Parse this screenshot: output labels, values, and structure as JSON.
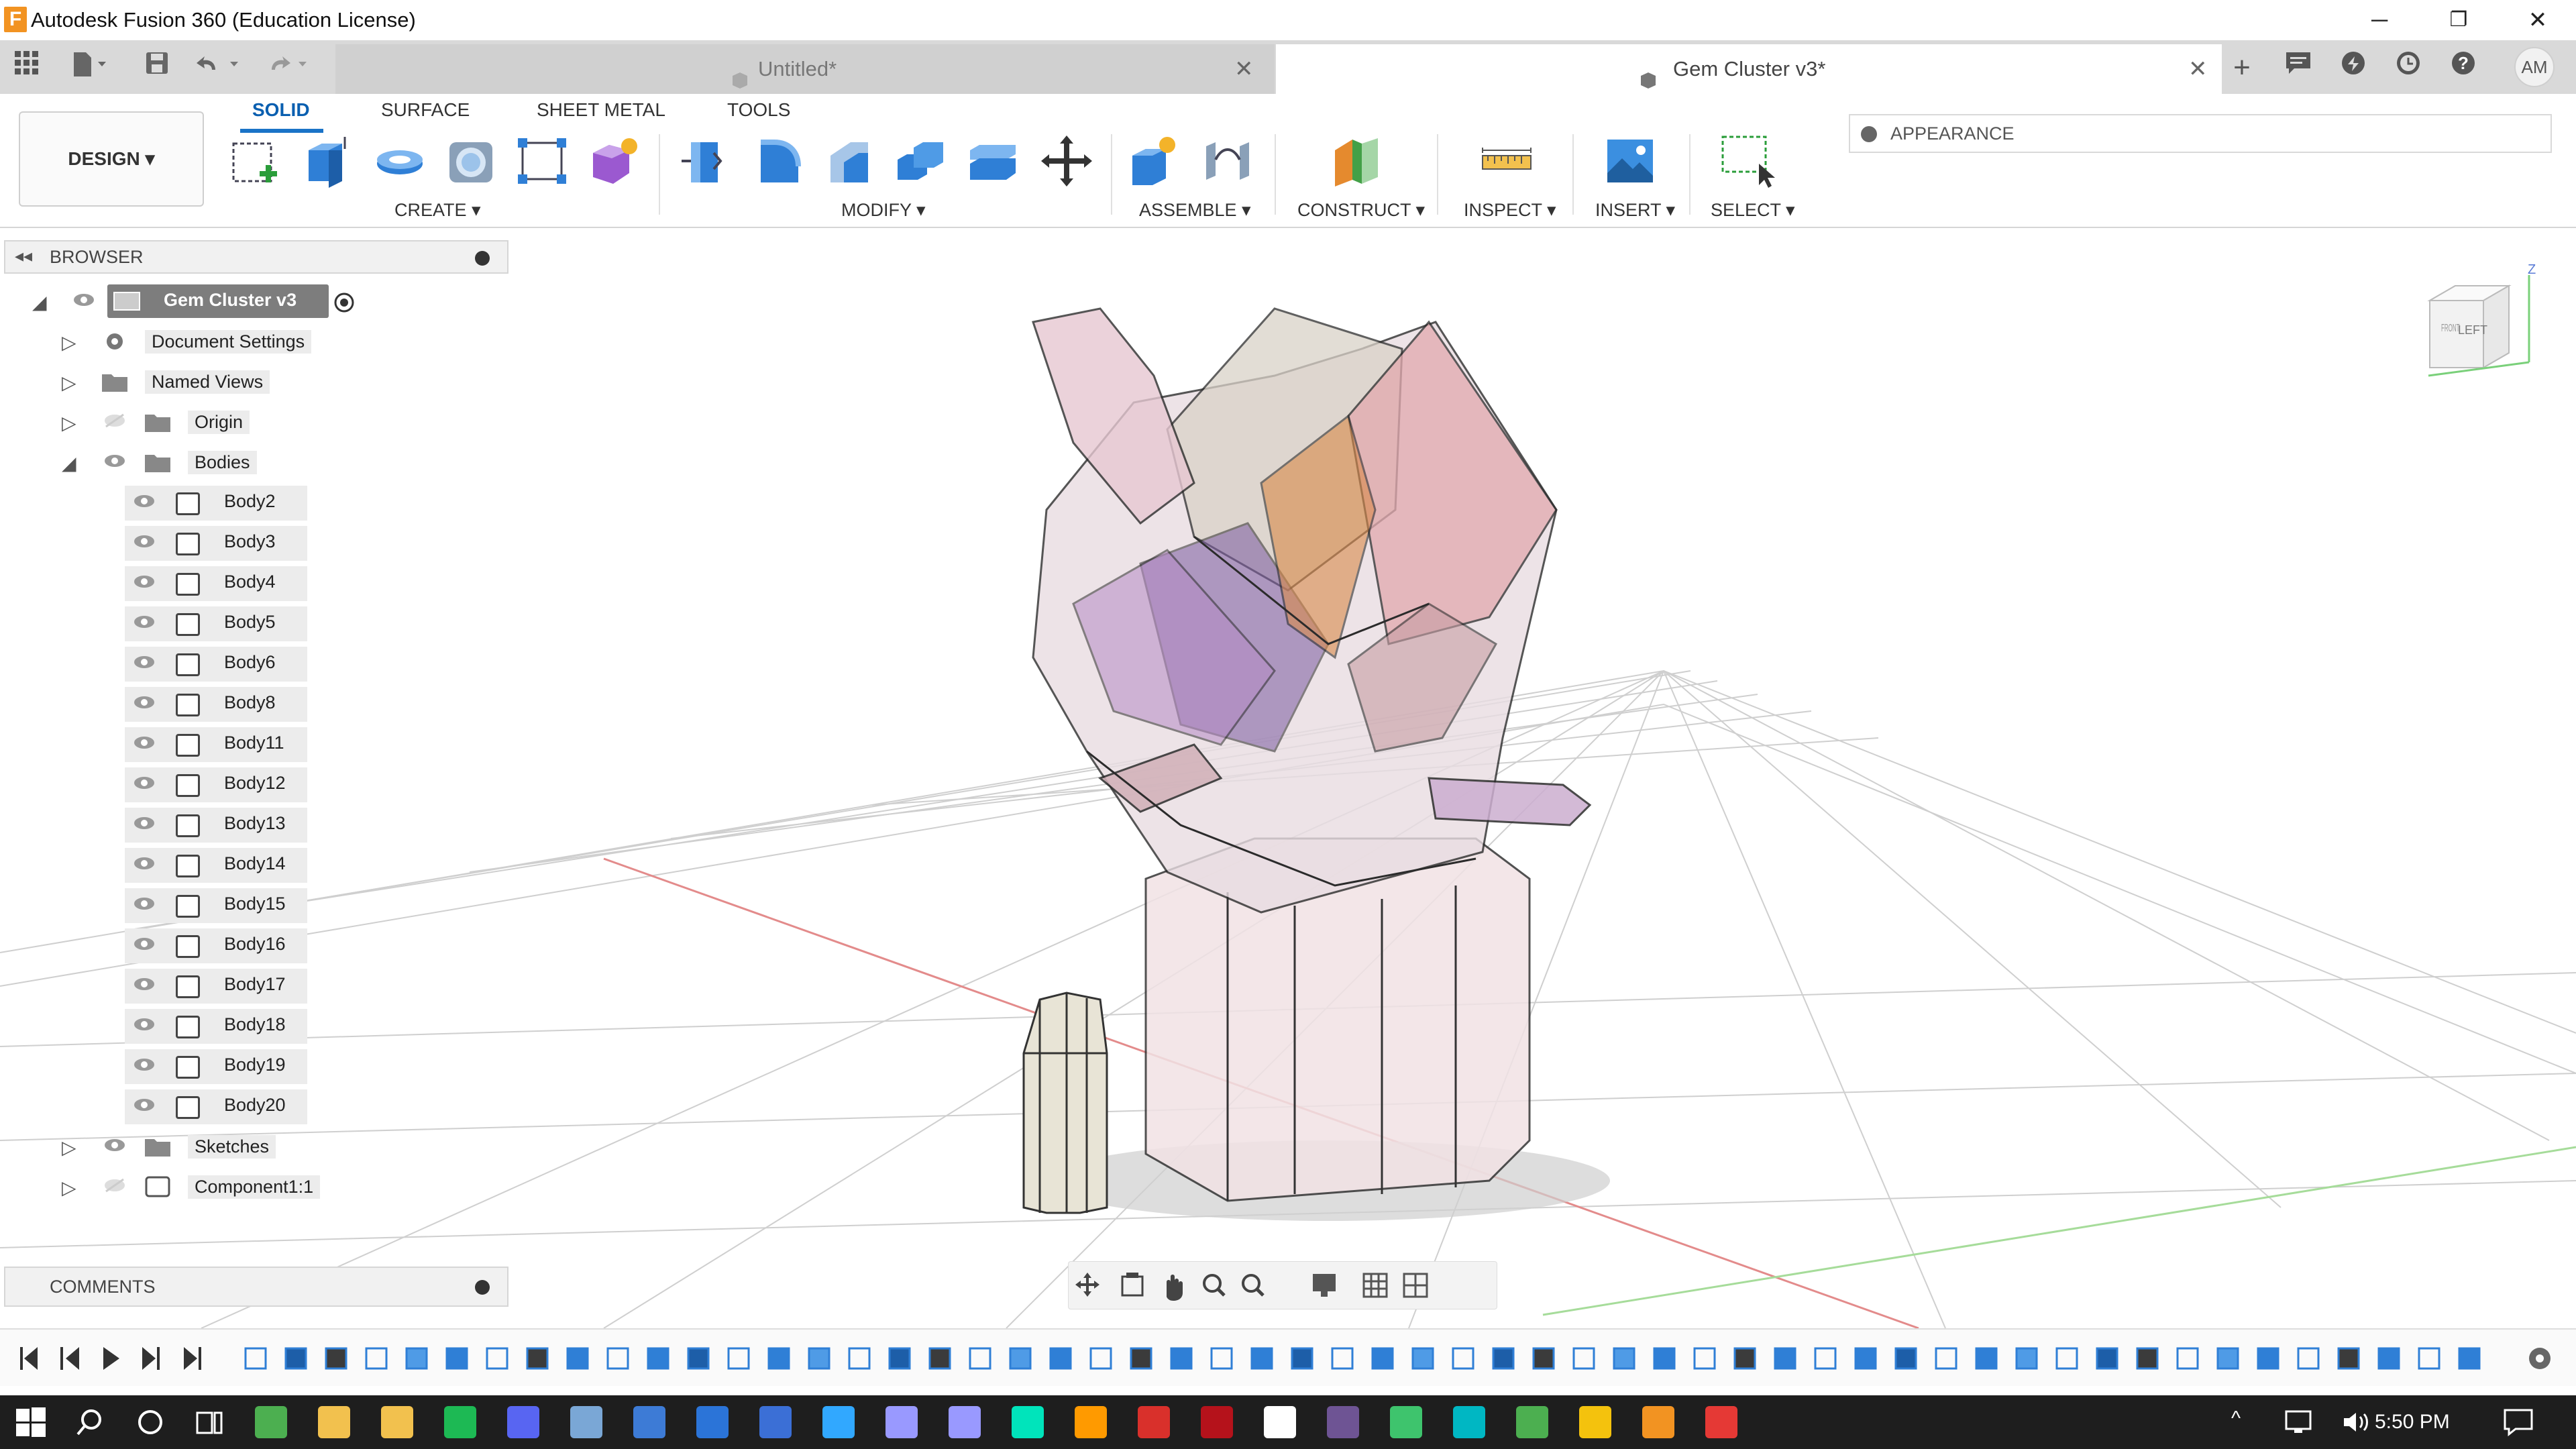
{
  "window": {
    "app_icon_letter": "F",
    "title": "Autodesk Fusion 360 (Education License)",
    "minimize": "─",
    "restore": "❐",
    "close": "✕"
  },
  "tabs": {
    "untitled": {
      "label": "Untitled*",
      "close": "✕"
    },
    "gem": {
      "label": "Gem Cluster v3*",
      "close": "✕"
    }
  },
  "user": {
    "initials": "AM"
  },
  "toolbar": {
    "workspace": "DESIGN ▾",
    "tabs": [
      "SOLID",
      "SURFACE",
      "SHEET METAL",
      "TOOLS"
    ],
    "groups": {
      "create": "CREATE ▾",
      "modify": "MODIFY ▾",
      "assemble": "ASSEMBLE ▾",
      "construct": "CONSTRUCT ▾",
      "inspect": "INSPECT ▾",
      "insert": "INSERT ▾",
      "select": "SELECT ▾"
    },
    "appearance": "APPEARANCE"
  },
  "browser": {
    "title": "BROWSER",
    "root": "Gem Cluster v3",
    "folders": {
      "document_settings": "Document Settings",
      "named_views": "Named Views",
      "origin": "Origin",
      "bodies": "Bodies",
      "sketches": "Sketches",
      "component": "Component1:1"
    },
    "bodies": [
      "Body2",
      "Body3",
      "Body4",
      "Body5",
      "Body6",
      "Body8",
      "Body11",
      "Body12",
      "Body13",
      "Body14",
      "Body15",
      "Body16",
      "Body17",
      "Body18",
      "Body19",
      "Body20"
    ]
  },
  "comments": {
    "title": "COMMENTS"
  },
  "viewcube": {
    "face_left": "LEFT",
    "face_front": "FRONT",
    "axis_z": "Z"
  },
  "taskbar": {
    "time": "5:50 PM"
  }
}
